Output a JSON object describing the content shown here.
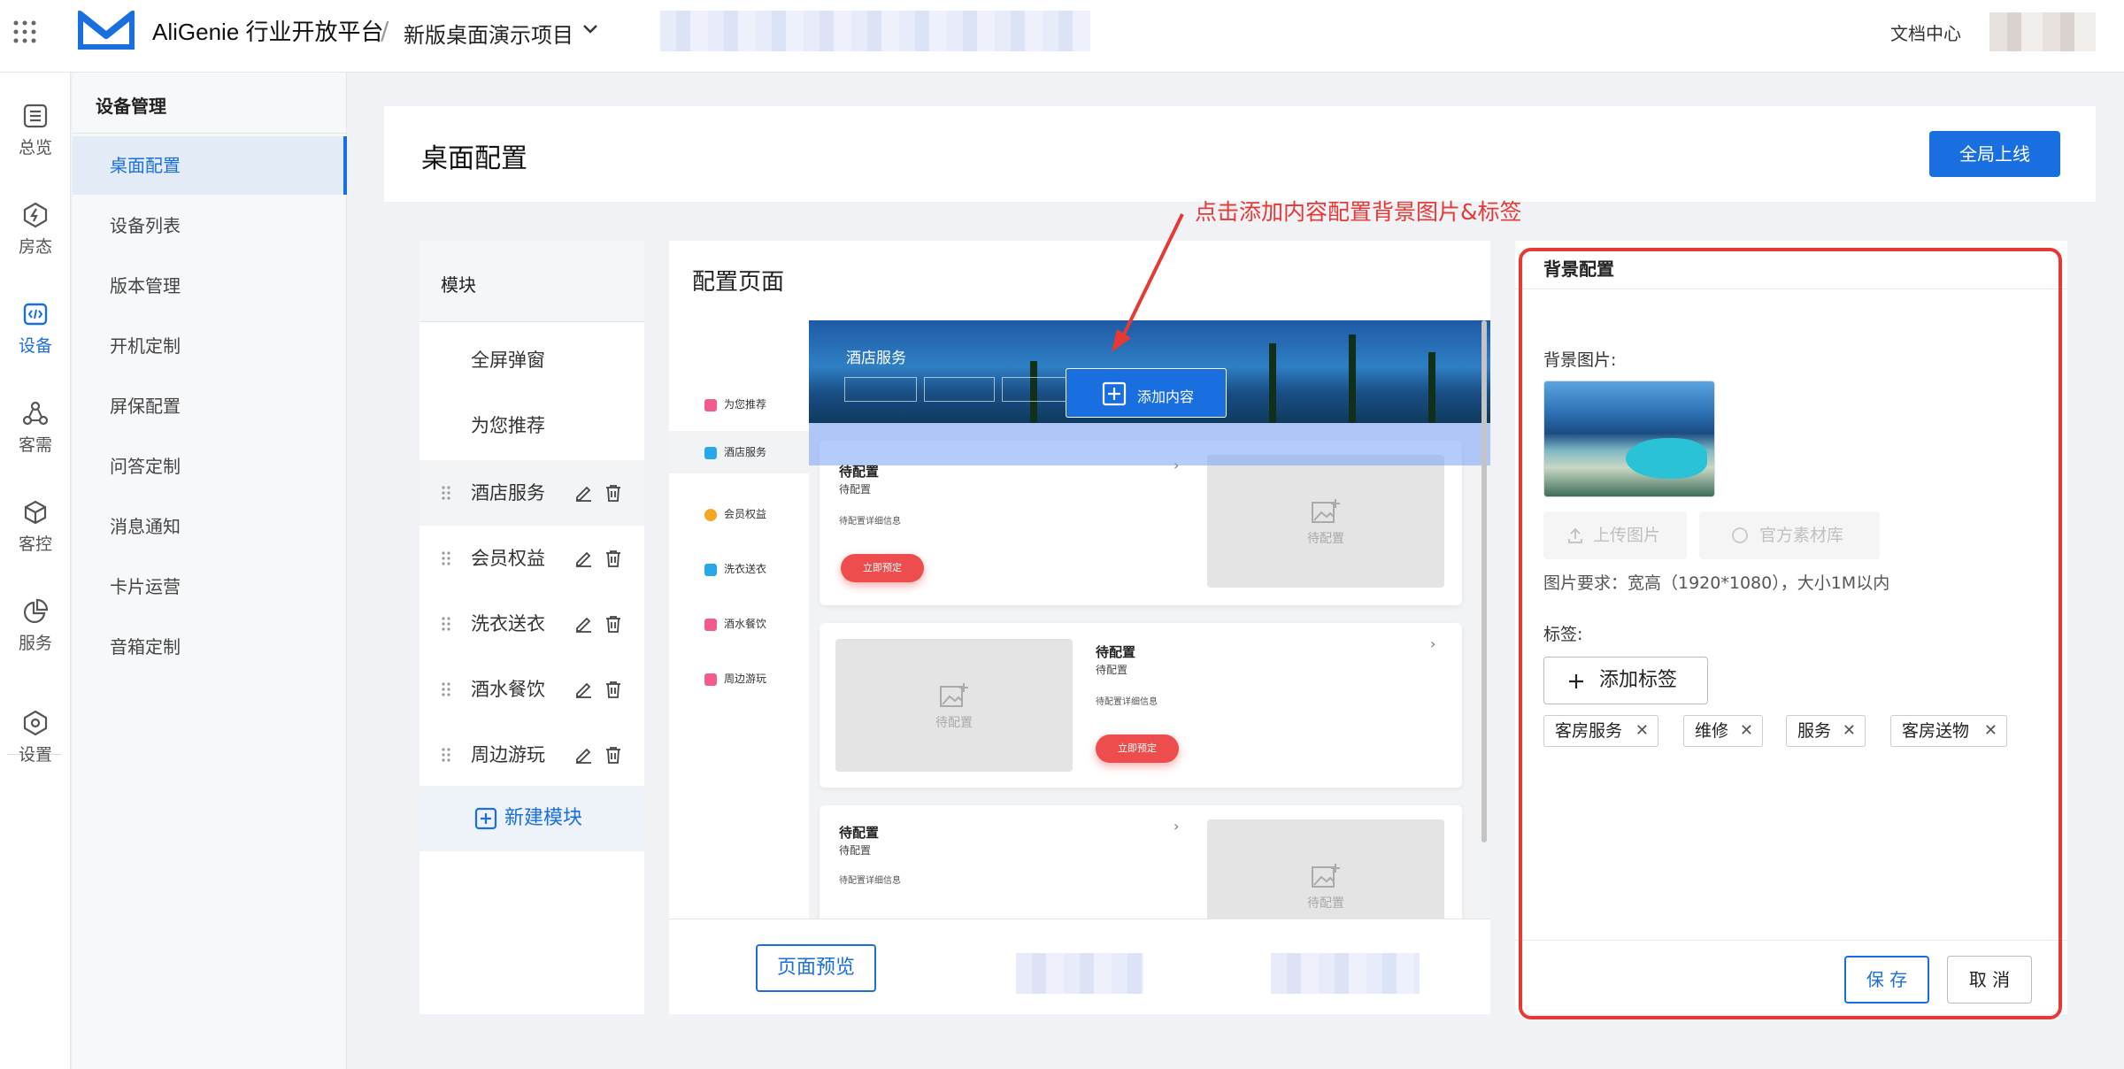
{
  "header": {
    "brand": "AliGenie 行业开放平台",
    "separator": "/",
    "project": "新版桌面演示项目",
    "docs": "文档中心"
  },
  "rail": {
    "items": [
      {
        "label": "总览",
        "icon": "list-icon"
      },
      {
        "label": "房态",
        "icon": "lightning-icon"
      },
      {
        "label": "设备",
        "icon": "code-icon"
      },
      {
        "label": "客需",
        "icon": "nodes-icon"
      },
      {
        "label": "客控",
        "icon": "cube-icon"
      },
      {
        "label": "服务",
        "icon": "pie-icon"
      },
      {
        "label": "设置",
        "icon": "hexagon-gear-icon"
      }
    ],
    "active": "设备"
  },
  "subnav": {
    "title": "设备管理",
    "items": [
      "桌面配置",
      "设备列表",
      "版本管理",
      "开机定制",
      "屏保配置",
      "问答定制",
      "消息通知",
      "卡片运营",
      "音箱定制"
    ],
    "active": "桌面配置"
  },
  "page": {
    "title": "桌面配置",
    "golive": "全局上线"
  },
  "modules": {
    "header": "模块",
    "static_items": [
      "全屏弹窗",
      "为您推荐"
    ],
    "editable_items": [
      "酒店服务",
      "会员权益",
      "洗衣送衣",
      "酒水餐饮",
      "周边游玩"
    ],
    "new_module": "新建模块"
  },
  "config": {
    "title": "配置页面",
    "categories": [
      {
        "label": "为您推荐",
        "color": "#f25c8a"
      },
      {
        "label": "酒店服务",
        "color": "#2aa7e8"
      },
      {
        "label": "会员权益",
        "color": "#f5a623"
      },
      {
        "label": "洗衣送衣",
        "color": "#2aa7e8"
      },
      {
        "label": "酒水餐饮",
        "color": "#f25c8a"
      },
      {
        "label": "周边游玩",
        "color": "#f25c8a"
      }
    ],
    "banner_title": "酒店服务",
    "add_content": "添加内容",
    "cards": [
      {
        "title": "待配置",
        "subtitle": "待配置",
        "detail": "待配置详细信息",
        "button": "立即预定",
        "placeholder": "待配置"
      },
      {
        "title": "待配置",
        "subtitle": "待配置",
        "detail": "待配置详细信息",
        "button": "立即预定",
        "placeholder": "待配置"
      },
      {
        "title": "待配置",
        "subtitle": "待配置",
        "detail": "待配置详细信息",
        "placeholder": "待配置"
      }
    ],
    "preview": "页面预览"
  },
  "background": {
    "title": "背景配置",
    "image_label": "背景图片:",
    "upload": "上传图片",
    "library": "官方素材库",
    "requirement": "图片要求：宽高（1920*1080），大小1M以内",
    "tags_label": "标签:",
    "add_tag": "添加标签",
    "tags": [
      "客房服务",
      "维修",
      "服务",
      "客房送物"
    ],
    "save": "保 存",
    "cancel": "取 消"
  },
  "annotation": "点击添加内容配置背景图片&标签",
  "colors": {
    "accent": "#1a6fe0",
    "annotation": "#e53935"
  }
}
